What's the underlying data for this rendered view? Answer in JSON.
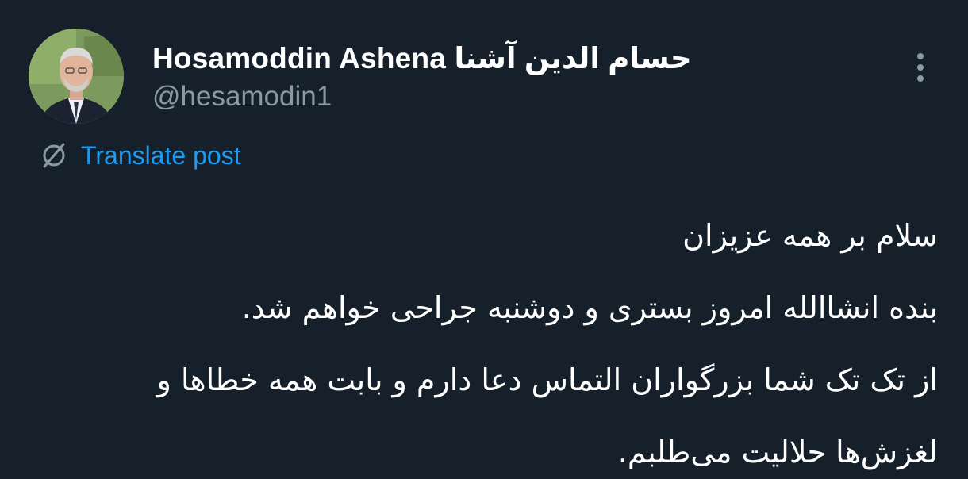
{
  "author": {
    "display_name": "Hosamoddin Ashena حسام الدين آشنا",
    "handle": "@hesamodin1",
    "avatar_icon": "profile-photo"
  },
  "menu": {
    "more_icon": "vertical-ellipsis-icon"
  },
  "translate": {
    "icon": "globe-translate-icon",
    "label": "Translate post",
    "color": "#1d9bf0"
  },
  "post": {
    "lines": [
      "سلام بر همه عزیزان",
      "بنده انشاالله امروز بستری و دوشنبه جراحی خواهم شد.",
      "از تک تک شما بزرگواران التماس دعا دارم و بابت همه خطاها و",
      "لغزش‌ها حلالیت می‌طلبم."
    ]
  },
  "theme": {
    "background": "#15202b",
    "primary_text": "#ffffff",
    "secondary_text": "#8b98a5"
  }
}
